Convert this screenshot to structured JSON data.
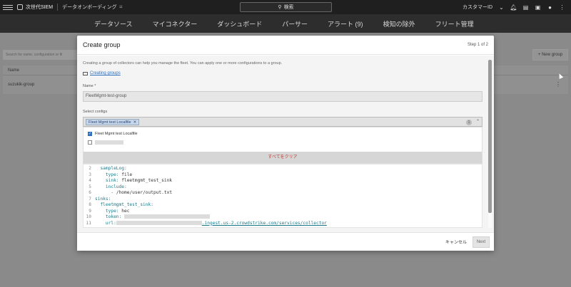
{
  "topbar": {
    "brand": "次世代SIEM",
    "breadcrumb": "データオンボーディング",
    "search_label": "検索",
    "customer": "カスタマーID"
  },
  "nav": {
    "items": [
      "データソース",
      "マイコネクター",
      "ダッシュボード",
      "パーサー",
      "アラート (9)",
      "検知の除外",
      "フリート管理"
    ]
  },
  "page": {
    "search_placeholder": "Search for name, configuration or fil",
    "new_group_label": "+ New group",
    "table_header": "Name",
    "rows": [
      "suzukik-group"
    ]
  },
  "modal": {
    "title": "Create group",
    "step": "Step 1 of 2",
    "description": "Creating a group of collectors can help you manage the fleet. You can apply one or more configurations to a group.",
    "link": "Creating groups",
    "name_label": "Name *",
    "name_value": "FleetMgmt-test-group",
    "select_label": "Select configs",
    "selected_chip": "Fleet Mgmt test Localfile",
    "selected_count": "1",
    "options": [
      {
        "label": "Fleet Mgmt test Localfile",
        "checked": true
      }
    ],
    "clear_all": "すべてをクリア",
    "code": {
      "lines": [
        {
          "n": "2",
          "k": "  sampleLog:",
          "v": ""
        },
        {
          "n": "3",
          "k": "    type:",
          "v": " file"
        },
        {
          "n": "4",
          "k": "    sink:",
          "v": " fleetmgmt_test_sink"
        },
        {
          "n": "5",
          "k": "    include:",
          "v": ""
        },
        {
          "n": "6",
          "k": "      - ",
          "v": "/home/user/output.txt"
        },
        {
          "n": "7",
          "k": "sinks:",
          "v": ""
        },
        {
          "n": "8",
          "k": "  fleetmgmt_test_sink:",
          "v": ""
        },
        {
          "n": "9",
          "k": "    type:",
          "v": " hec"
        },
        {
          "n": "10",
          "k": "    token:",
          "v": ""
        },
        {
          "n": "11",
          "k": "    url:",
          "v": " https://"
        }
      ],
      "url_suffix": ".ingest.us-2.crowdstrike.com/services/collector"
    },
    "cancel": "キャンセル",
    "next": "Next"
  }
}
